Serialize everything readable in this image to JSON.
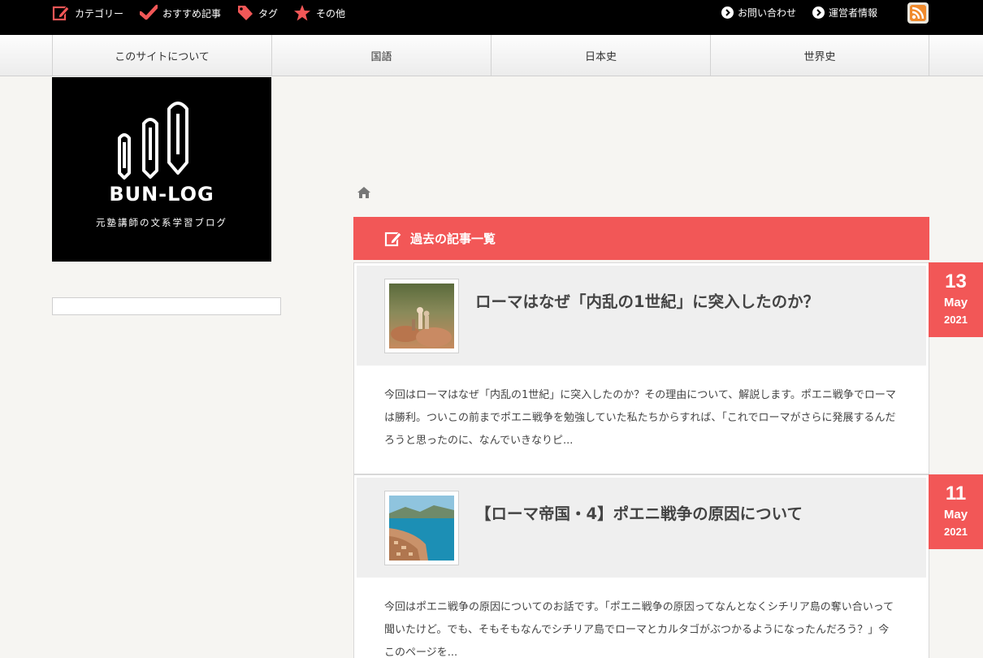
{
  "topnav": {
    "items": [
      {
        "label": "カテゴリー",
        "icon": "edit-icon"
      },
      {
        "label": "おすすめ記事",
        "icon": "check-icon"
      },
      {
        "label": "タグ",
        "icon": "tag-icon"
      },
      {
        "label": "その他",
        "icon": "star-icon"
      }
    ],
    "links": [
      {
        "label": "お問い合わせ",
        "icon": "chevron-circle-icon"
      },
      {
        "label": "運営者情報",
        "icon": "chevron-circle-icon"
      }
    ],
    "rss_icon": "rss-icon"
  },
  "mainnav": {
    "items": [
      "このサイトについて",
      "国語",
      "日本史",
      "世界史"
    ]
  },
  "logo": {
    "title": "BUN-LOG",
    "subtitle": "元塾講師の文系学習ブログ"
  },
  "list": {
    "heading": "過去の記事一覧"
  },
  "articles": [
    {
      "title": "ローマはなぜ「内乱の1世紀」に突入したのか？",
      "excerpt": "今回はローマはなぜ「内乱の1世紀」に突入したのか？その理由について、解説します。ポエニ戦争でローマは勝利。ついこの前までポエニ戦争を勉強していた私たちからすれば、「これでローマがさらに発展するんだろうと思ったのに、なんでいきなりピ...",
      "date": {
        "day": "13",
        "month": "May",
        "year": "2021"
      }
    },
    {
      "title": "【ローマ帝国・4】ポエニ戦争の原因について",
      "excerpt": "今回はポエニ戦争の原因についてのお話です。「ポエニ戦争の原因ってなんとなくシチリア島の奪い合いって聞いたけど。でも、そもそもなんでシチリア島でローマとカルタゴがぶつかるようになったんだろう？」今このページを...",
      "date": {
        "day": "11",
        "month": "May",
        "year": "2021"
      }
    }
  ],
  "colors": {
    "accent": "#f25757",
    "topbar": "#000000",
    "background": "#f6f5f2"
  }
}
